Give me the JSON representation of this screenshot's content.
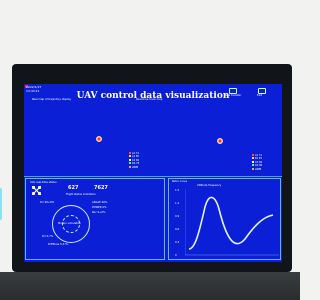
{
  "header": {
    "title": "UAV control data visualization",
    "date": "2022/1/27",
    "time": "13:43:41",
    "left_caption": "Real map of trajectory display",
    "center_caption": "Real-time track map",
    "right_btn_1": "Data transfer",
    "right_btn_2": "Exit"
  },
  "legend_left": [
    "A1 74",
    "A1 85",
    "C4 69",
    "D4 78",
    "LNPB"
  ],
  "legend_right": [
    "A1 74",
    "B1 85",
    "C4 69",
    "D4 80",
    "LNPB"
  ],
  "left_panel": {
    "caption": "UAV real-time status",
    "count_a": "627",
    "count_b": "7627",
    "subtitle": "Flight status indicators",
    "line_1": "Dir 90+0%",
    "line_2": "ANGLE 40%",
    "line_3": "POWER 0%",
    "line_4": "Rec 9+0%",
    "line_5": "Dir 0.7%",
    "center_label": "Motion simulation",
    "bottom_label": "DiffTorse 0.37%"
  },
  "right_panel": {
    "caption": "Rotor curve",
    "legend": "Attitude frequency",
    "y_ticks": [
      "1.5",
      "1.2",
      "0.9",
      "0.6",
      "0.3",
      "0"
    ]
  },
  "colors": {
    "screen": "#0b1fd6",
    "accent": "#4aa3ff",
    "curve": "#dfefff"
  },
  "icons": [
    "uav-icon",
    "settings-icon",
    "exit-icon"
  ]
}
